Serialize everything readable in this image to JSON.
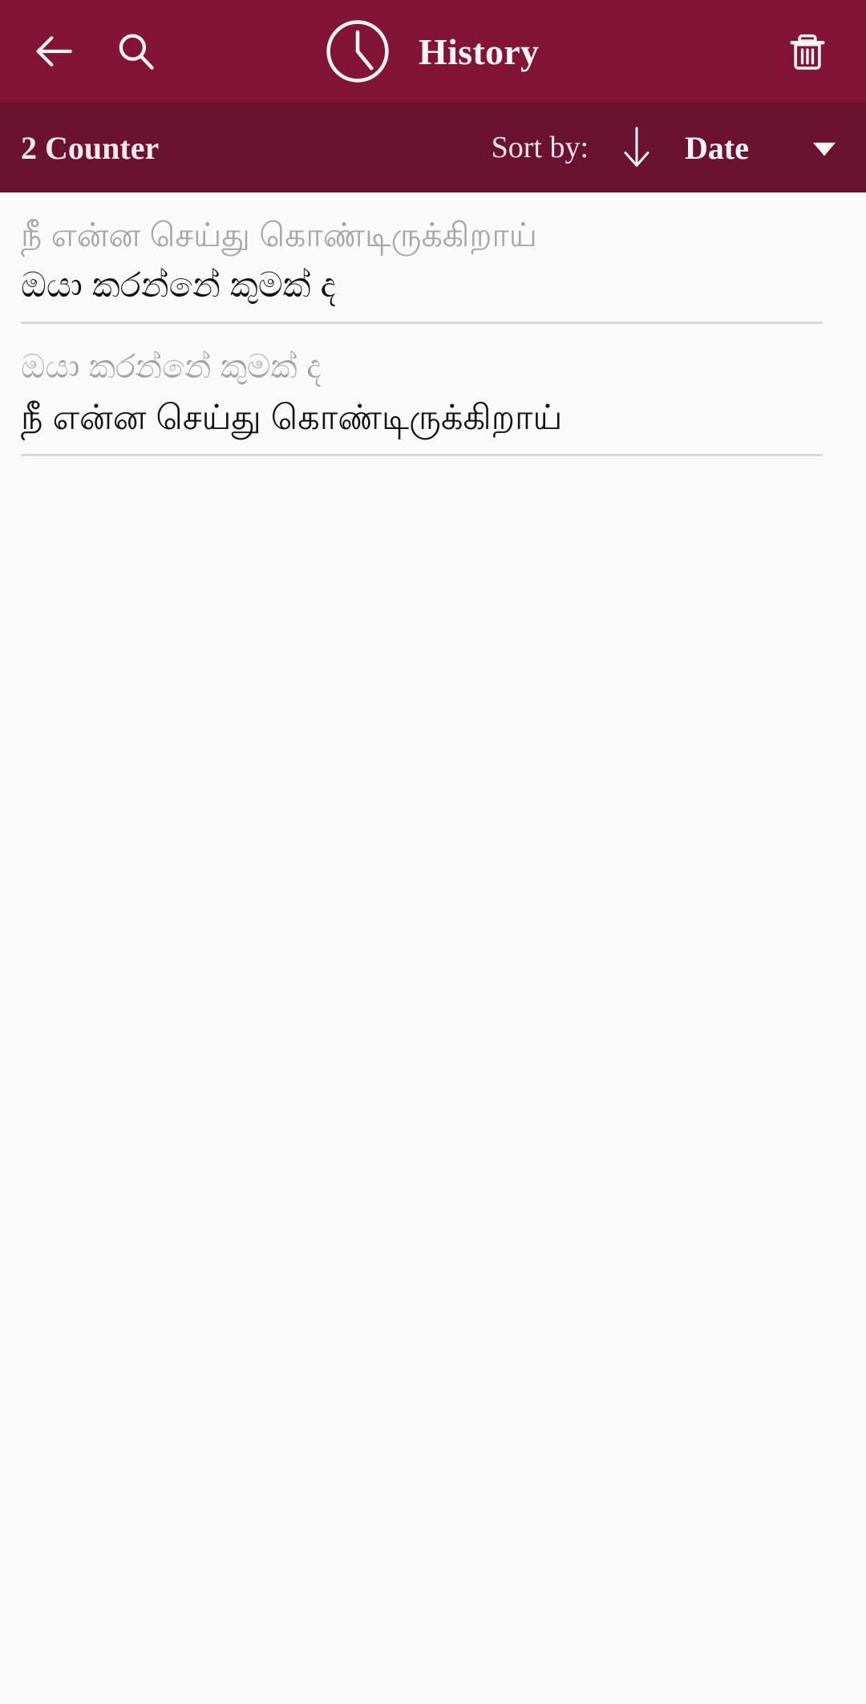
{
  "theme": {
    "appbar_color": "#821437",
    "sortbar_color": "#6b1230",
    "page_background": "#fafafa",
    "source_text_color": "#a6a6a6",
    "target_text_color": "#121212",
    "divider_color": "#d8d8d8",
    "on_primary_color": "#fdf4f6"
  },
  "appbar": {
    "back_icon": "arrow-left-icon",
    "search_icon": "search-icon",
    "clock_icon": "clock-icon",
    "title": "History",
    "delete_icon": "trash-icon"
  },
  "sortbar": {
    "counter": "2 Counter",
    "sort_by_label": "Sort by:",
    "sort_direction_icon": "arrow-down-icon",
    "sort_value": "Date",
    "dropdown_icon": "caret-down-icon"
  },
  "history": {
    "items": [
      {
        "source": "நீ என்ன செய்து கொண்டிருக்கிறாய்",
        "target": "ඔයා කරන්නේ කුමක් ද"
      },
      {
        "source": "ඔයා කරන්නේ කුමක් ද",
        "target": "நீ என்ன செய்து கொண்டிருக்கிறாய்"
      }
    ]
  }
}
